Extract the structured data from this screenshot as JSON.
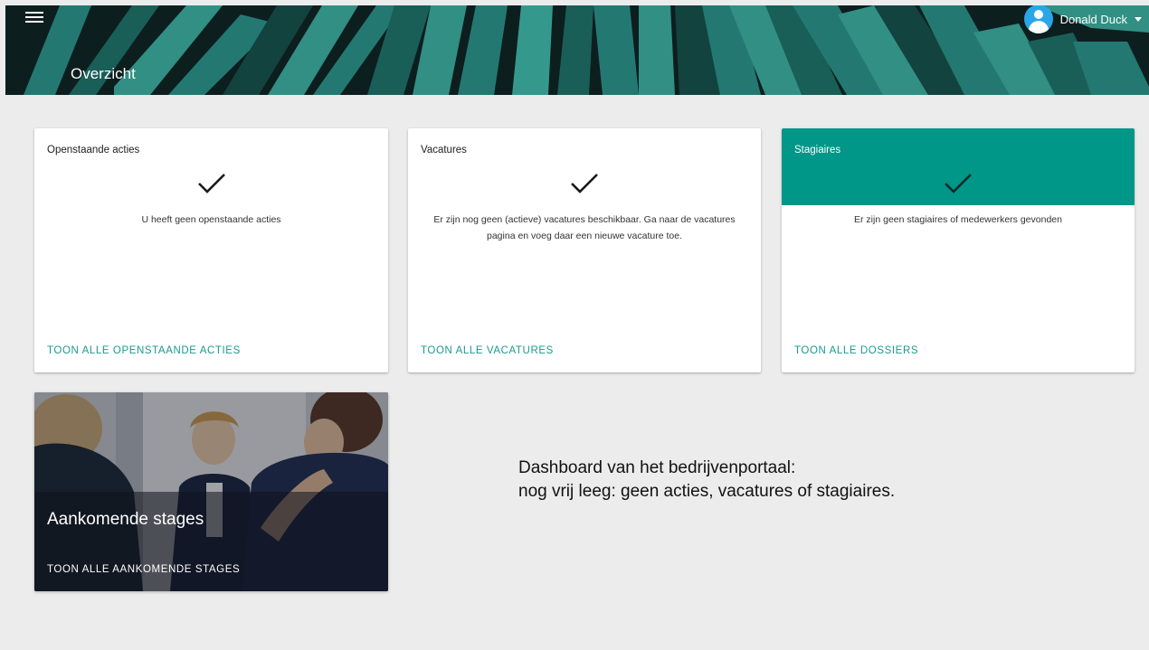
{
  "header": {
    "title": "Overzicht",
    "user_name": "Donald Duck",
    "menu_icon": "hamburger-menu-icon",
    "avatar_icon": "user-avatar-icon",
    "banner_colors": [
      "#2a8f86",
      "#3aa89c",
      "#1f6f68",
      "#0f2222"
    ]
  },
  "cards": [
    {
      "title": "Openstaande acties",
      "message": "U heeft geen openstaande acties",
      "link": "TOON ALLE OPENSTAANDE ACTIES",
      "icon": "checkmark-icon"
    },
    {
      "title": "Vacatures",
      "message": "Er zijn nog geen (actieve) vacatures beschikbaar. Ga naar de vacatures pagina en voeg daar een nieuwe vacature toe.",
      "link": "TOON ALLE VACATURES",
      "icon": "checkmark-icon"
    },
    {
      "title": "Stagiaires",
      "message": "Er zijn geen stagiaires of medewerkers gevonden",
      "link": "TOON ALLE DOSSIERS",
      "icon": "checkmark-icon",
      "accent_color": "#009688"
    }
  ],
  "image_card": {
    "title": "Aankomende stages",
    "link": "TOON ALLE AANKOMENDE STAGES"
  },
  "annotation": {
    "line1": "Dashboard van het bedrijvenportaal:",
    "line2": "nog vrij leeg: geen acties, vacatures of stagiaires."
  },
  "colors": {
    "link": "#189b8f",
    "accent": "#009688",
    "background": "#ececec"
  }
}
